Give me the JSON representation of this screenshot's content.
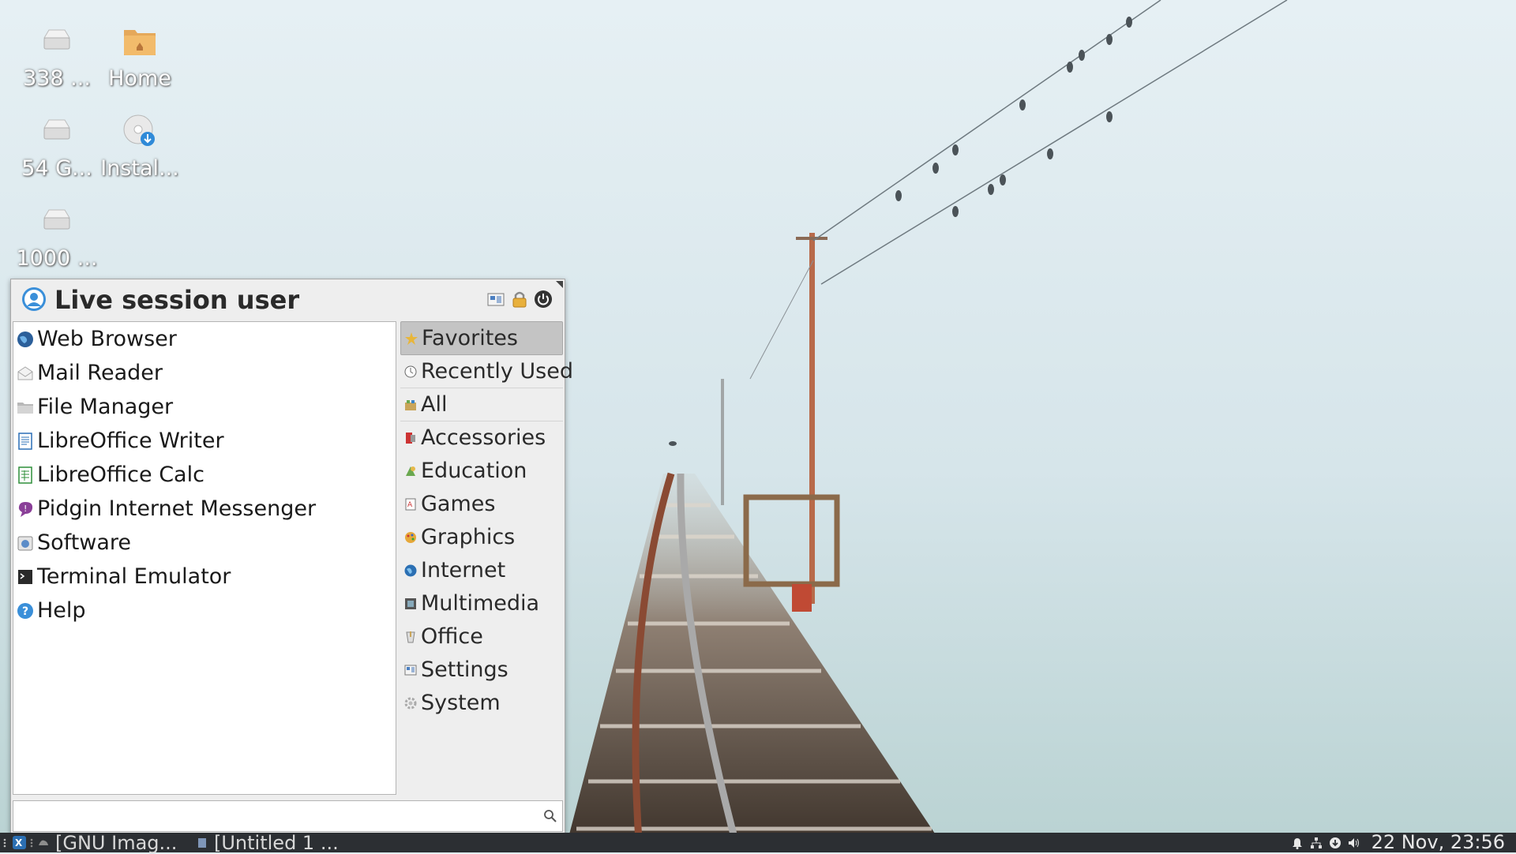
{
  "desktop": {
    "icons": [
      {
        "label": "338 ...",
        "icon": "drive-icon"
      },
      {
        "label": "Home",
        "icon": "home-folder-icon"
      },
      {
        "label": "54 G...",
        "icon": "drive-icon"
      },
      {
        "label": "Instal...",
        "icon": "install-disc-icon"
      },
      {
        "label": "1000 ...",
        "icon": "drive-icon"
      }
    ]
  },
  "menu": {
    "user_name": "Live session user",
    "header_buttons": [
      "settings-icon",
      "lock-icon",
      "power-icon"
    ],
    "favorites": [
      {
        "label": "Web Browser",
        "icon": "globe-icon"
      },
      {
        "label": "Mail Reader",
        "icon": "mail-icon"
      },
      {
        "label": "File Manager",
        "icon": "folder-icon"
      },
      {
        "label": "LibreOffice Writer",
        "icon": "writer-icon"
      },
      {
        "label": "LibreOffice Calc",
        "icon": "calc-icon"
      },
      {
        "label": "Pidgin Internet Messenger",
        "icon": "pidgin-icon"
      },
      {
        "label": "Software",
        "icon": "software-icon"
      },
      {
        "label": "Terminal Emulator",
        "icon": "terminal-icon"
      },
      {
        "label": "Help",
        "icon": "help-icon"
      }
    ],
    "categories": [
      {
        "label": "Favorites",
        "icon": "star-icon",
        "selected": true
      },
      {
        "label": "Recently Used",
        "icon": "clock-icon"
      },
      {
        "label": "All",
        "icon": "all-apps-icon"
      },
      {
        "label": "Accessories",
        "icon": "accessories-icon"
      },
      {
        "label": "Education",
        "icon": "education-icon"
      },
      {
        "label": "Games",
        "icon": "games-icon"
      },
      {
        "label": "Graphics",
        "icon": "graphics-icon"
      },
      {
        "label": "Internet",
        "icon": "internet-icon"
      },
      {
        "label": "Multimedia",
        "icon": "multimedia-icon"
      },
      {
        "label": "Office",
        "icon": "office-icon"
      },
      {
        "label": "Settings",
        "icon": "settings-icon"
      },
      {
        "label": "System",
        "icon": "system-icon"
      }
    ],
    "search": {
      "value": "",
      "placeholder": ""
    }
  },
  "taskbar": {
    "tasks": [
      {
        "label": "[GNU Imag..."
      },
      {
        "label": "[Untitled 1 ..."
      }
    ],
    "clock": "22 Nov, 23:56"
  },
  "colors": {
    "taskbar_bg": "#2c2f33",
    "menu_bg": "#eeeeee",
    "selected_category": "#c4c4c4"
  }
}
